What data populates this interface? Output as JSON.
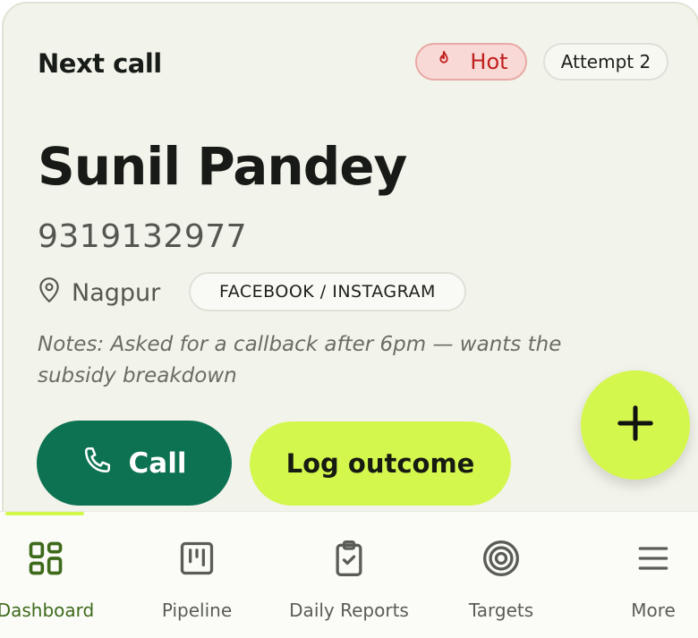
{
  "card": {
    "header": "Next call",
    "hot_badge": "Hot",
    "attempt_badge": "Attempt 2",
    "lead": {
      "name": "Sunil Pandey",
      "phone": "9319132977",
      "city": "Nagpur",
      "source": "FACEBOOK / INSTAGRAM",
      "notes": "Notes: Asked for a callback after 6pm — wants the subsidy breakdown"
    },
    "actions": {
      "call_label": "Call",
      "log_label": "Log outcome"
    }
  },
  "nav": {
    "items": [
      {
        "label": "Dashboard",
        "icon": "dashboard-grid-icon",
        "active": true
      },
      {
        "label": "Pipeline",
        "icon": "kanban-icon",
        "active": false
      },
      {
        "label": "Daily Reports",
        "icon": "clipboard-check-icon",
        "active": false
      },
      {
        "label": "Targets",
        "icon": "target-icon",
        "active": false
      },
      {
        "label": "More",
        "icon": "menu-icon",
        "active": false
      }
    ]
  },
  "colors": {
    "accent_lime": "#d4f74e",
    "primary_green": "#0d7252",
    "hot_red": "#c0201e",
    "active_nav": "#3e6a1b"
  }
}
